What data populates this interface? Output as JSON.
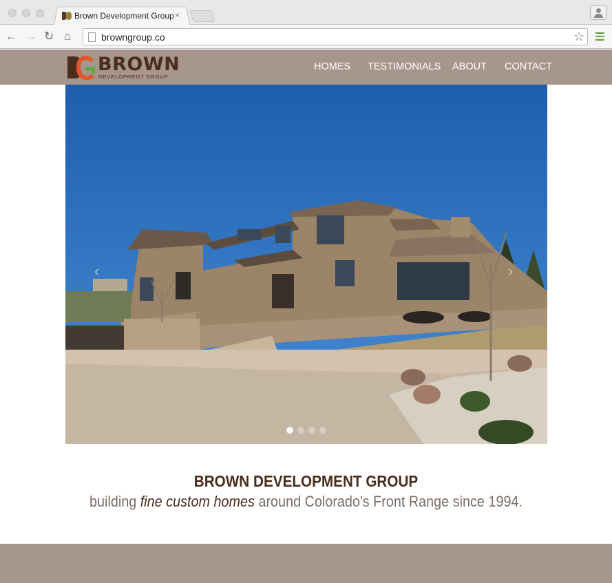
{
  "browser": {
    "tab_title": "Brown Development Group",
    "tab_close": "×",
    "url": "browngroup.co",
    "icons": [
      "back-arrow-icon",
      "forward-arrow-icon",
      "reload-icon",
      "home-icon",
      "page-icon",
      "star-icon",
      "menu-icon",
      "profile-icon"
    ]
  },
  "site": {
    "logo_word": "BROWN",
    "logo_sub": "DEVELOPMENT GROUP",
    "nav": [
      "HOMES",
      "TESTIMONIALS",
      "ABOUT",
      "CONTACT"
    ],
    "colors": {
      "header_bg": "#a7968b",
      "brand_brown": "#4a2d1c",
      "brand_orange": "#e2582a",
      "brand_green": "#5fa545"
    }
  },
  "hero": {
    "prev_arrow": "‹",
    "next_arrow": "›",
    "slides_total": 4,
    "active_slide": 1
  },
  "intro": {
    "headline": "BROWN DEVELOPMENT GROUP",
    "tagline_before": "building ",
    "tagline_emphasis": "fine custom homes",
    "tagline_after": " around Colorado's Front Range since 1994."
  }
}
